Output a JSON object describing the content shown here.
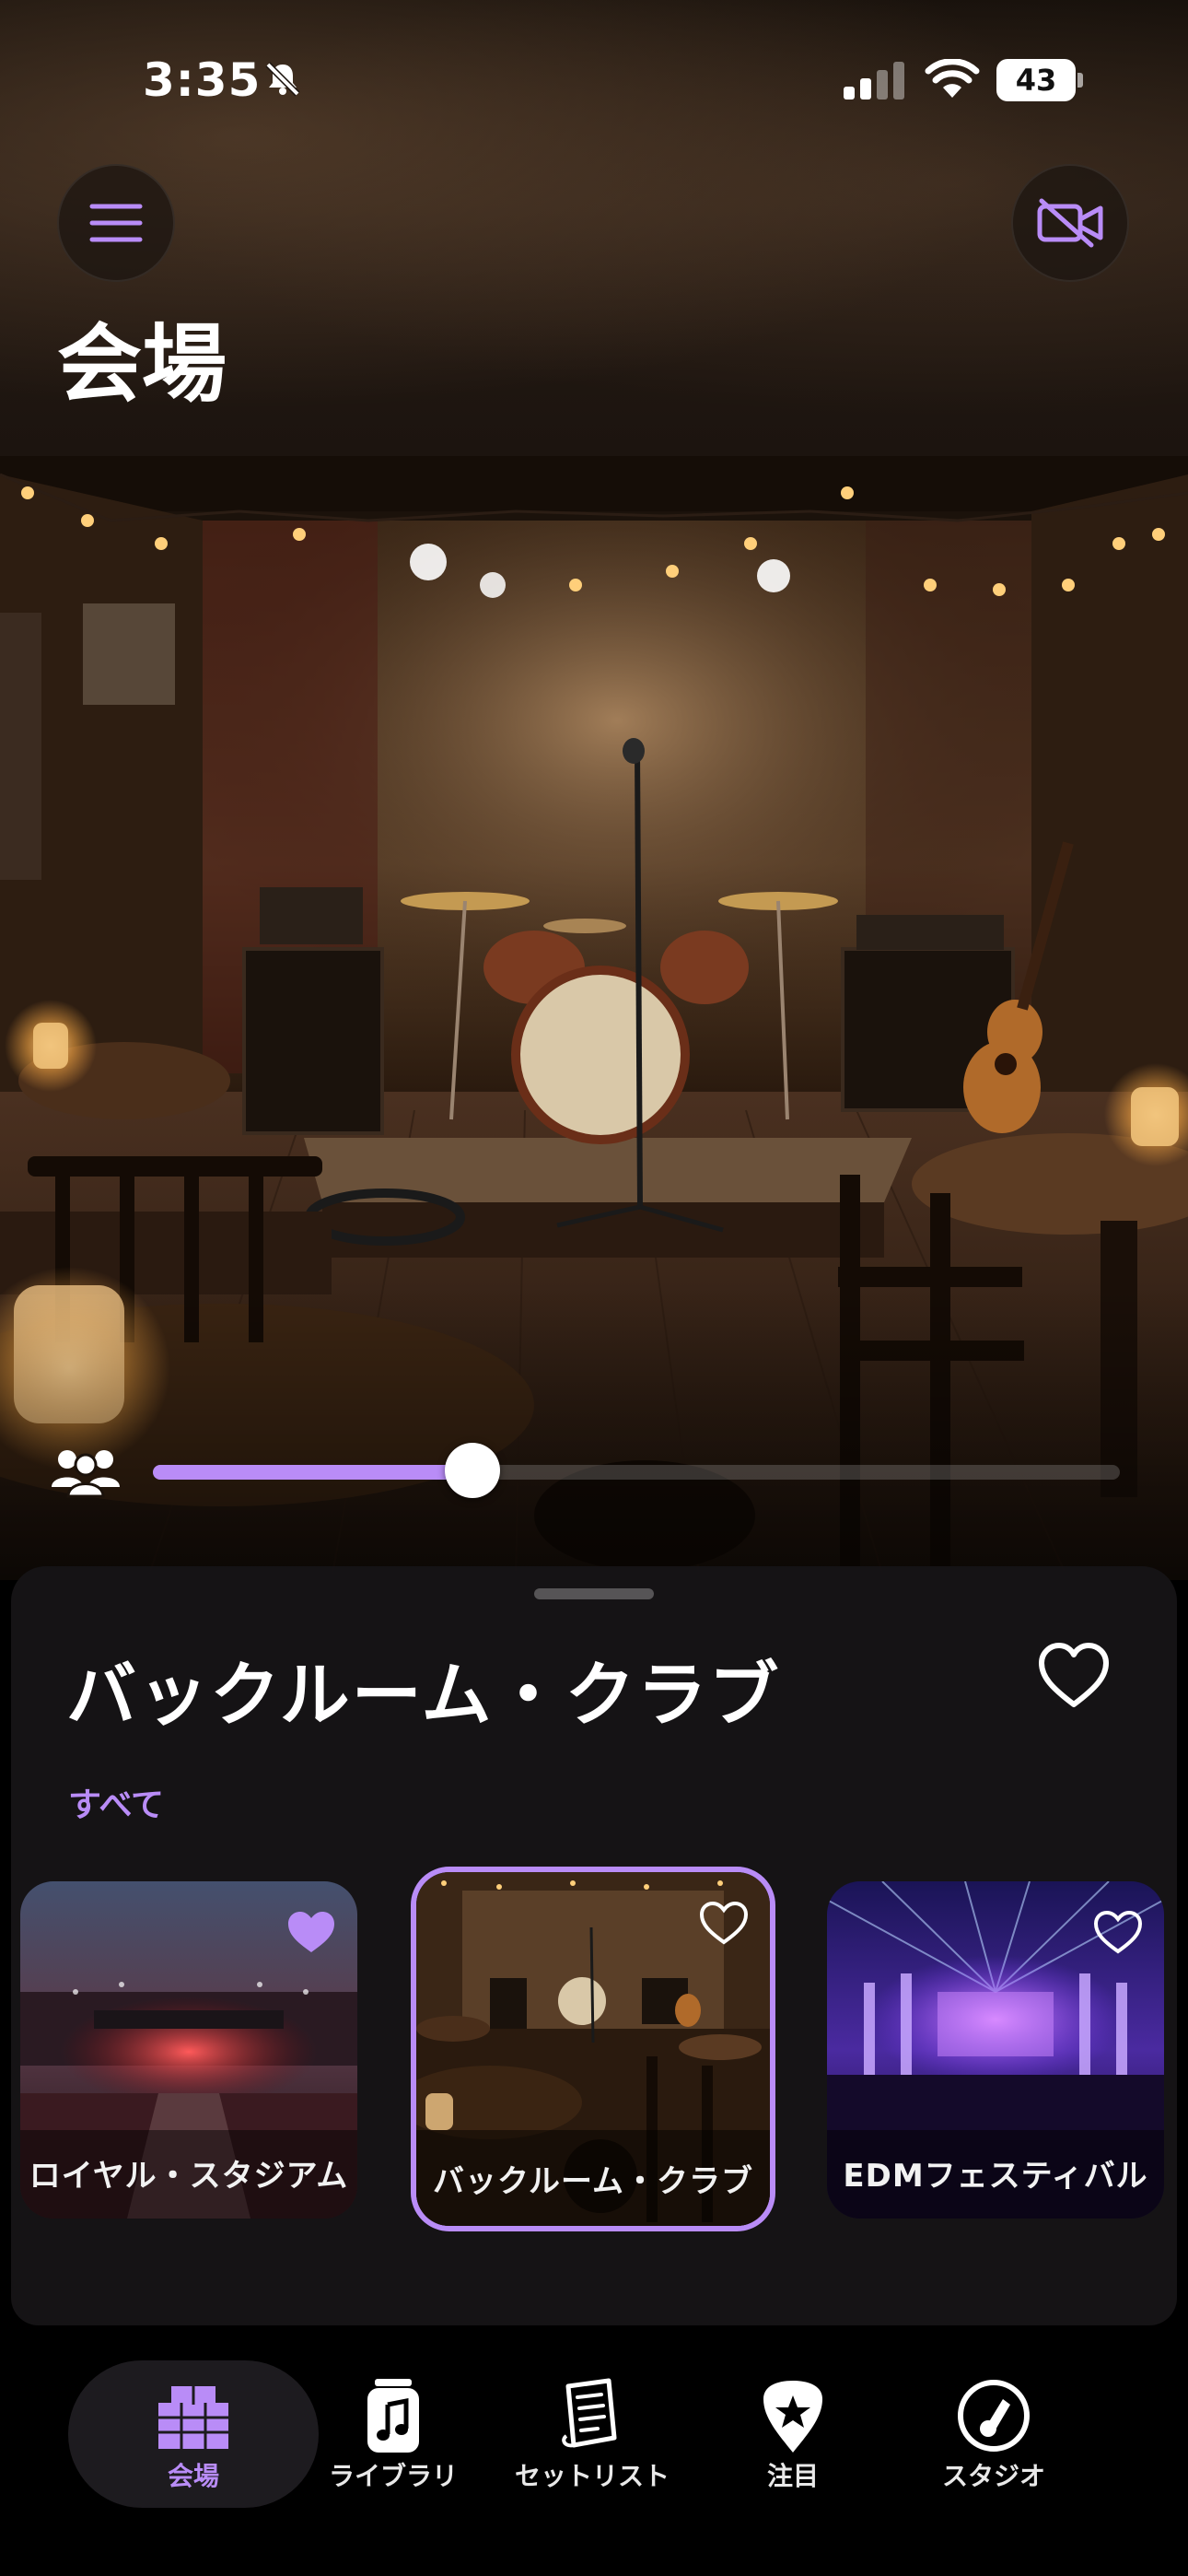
{
  "status_bar": {
    "time": "3:35",
    "battery": "43"
  },
  "header": {
    "title": "会場"
  },
  "hero": {
    "audience_level": 0.33
  },
  "venue_sheet": {
    "title": "バックルーム・クラブ",
    "filter": "すべて",
    "cards": [
      {
        "label": "ロイヤル・スタジアム",
        "favorite": true
      },
      {
        "label": "バックルーム・クラブ",
        "favorite": false,
        "selected": true
      },
      {
        "label": "EDMフェスティバル",
        "favorite": false
      }
    ]
  },
  "tabbar": {
    "tabs": [
      {
        "label": "会場",
        "icon": "venue-building-icon",
        "selected": true
      },
      {
        "label": "ライブラリ",
        "icon": "music-note-card-icon"
      },
      {
        "label": "セットリスト",
        "icon": "setlist-paper-icon"
      },
      {
        "label": "注目",
        "icon": "guitar-pick-star-icon"
      },
      {
        "label": "スタジオ",
        "icon": "record-disc-icon"
      }
    ]
  },
  "colors": {
    "accent": "#b98cf7",
    "background": "#000000"
  }
}
